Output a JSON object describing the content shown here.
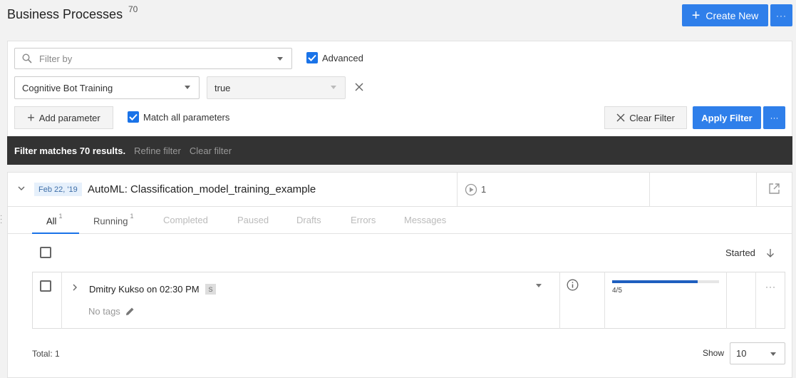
{
  "header": {
    "title": "Business Processes",
    "count": "70",
    "create_label": "Create New",
    "more_label": "···"
  },
  "filter": {
    "search_placeholder": "Filter by",
    "advanced_label": "Advanced",
    "advanced_checked": true,
    "param_select_value": "Cognitive Bot Training",
    "param_value": "true",
    "add_param_label": "Add parameter",
    "match_all_label": "Match all parameters",
    "match_all_checked": true,
    "clear_label": "Clear Filter",
    "apply_label": "Apply Filter",
    "apply_more_label": "···"
  },
  "status": {
    "message": "Filter matches 70 results.",
    "refine_label": "Refine filter",
    "clear_label": "Clear filter"
  },
  "process": {
    "date": "Feb 22, '19",
    "title": "AutoML: Classification_model_training_example",
    "run_count": "1"
  },
  "tabs": [
    {
      "label": "All",
      "count": "1"
    },
    {
      "label": "Running",
      "count": "1"
    },
    {
      "label": "Completed",
      "count": ""
    },
    {
      "label": "Paused",
      "count": ""
    },
    {
      "label": "Drafts",
      "count": ""
    },
    {
      "label": "Errors",
      "count": ""
    },
    {
      "label": "Messages",
      "count": ""
    }
  ],
  "list": {
    "sort_label": "Started",
    "rows": [
      {
        "user": "Dmitry Kukso on 02:30 PM",
        "badge": "S",
        "tags": "No tags",
        "progress_text": "4/5",
        "progress_fraction": 0.8,
        "more_label": "···"
      }
    ]
  },
  "footer": {
    "total": "Total: 1",
    "show_label": "Show",
    "page_size": "10"
  },
  "colors": {
    "accent": "#2f7fea",
    "status_bar": "#333333",
    "progress": "#1f5fbf"
  }
}
